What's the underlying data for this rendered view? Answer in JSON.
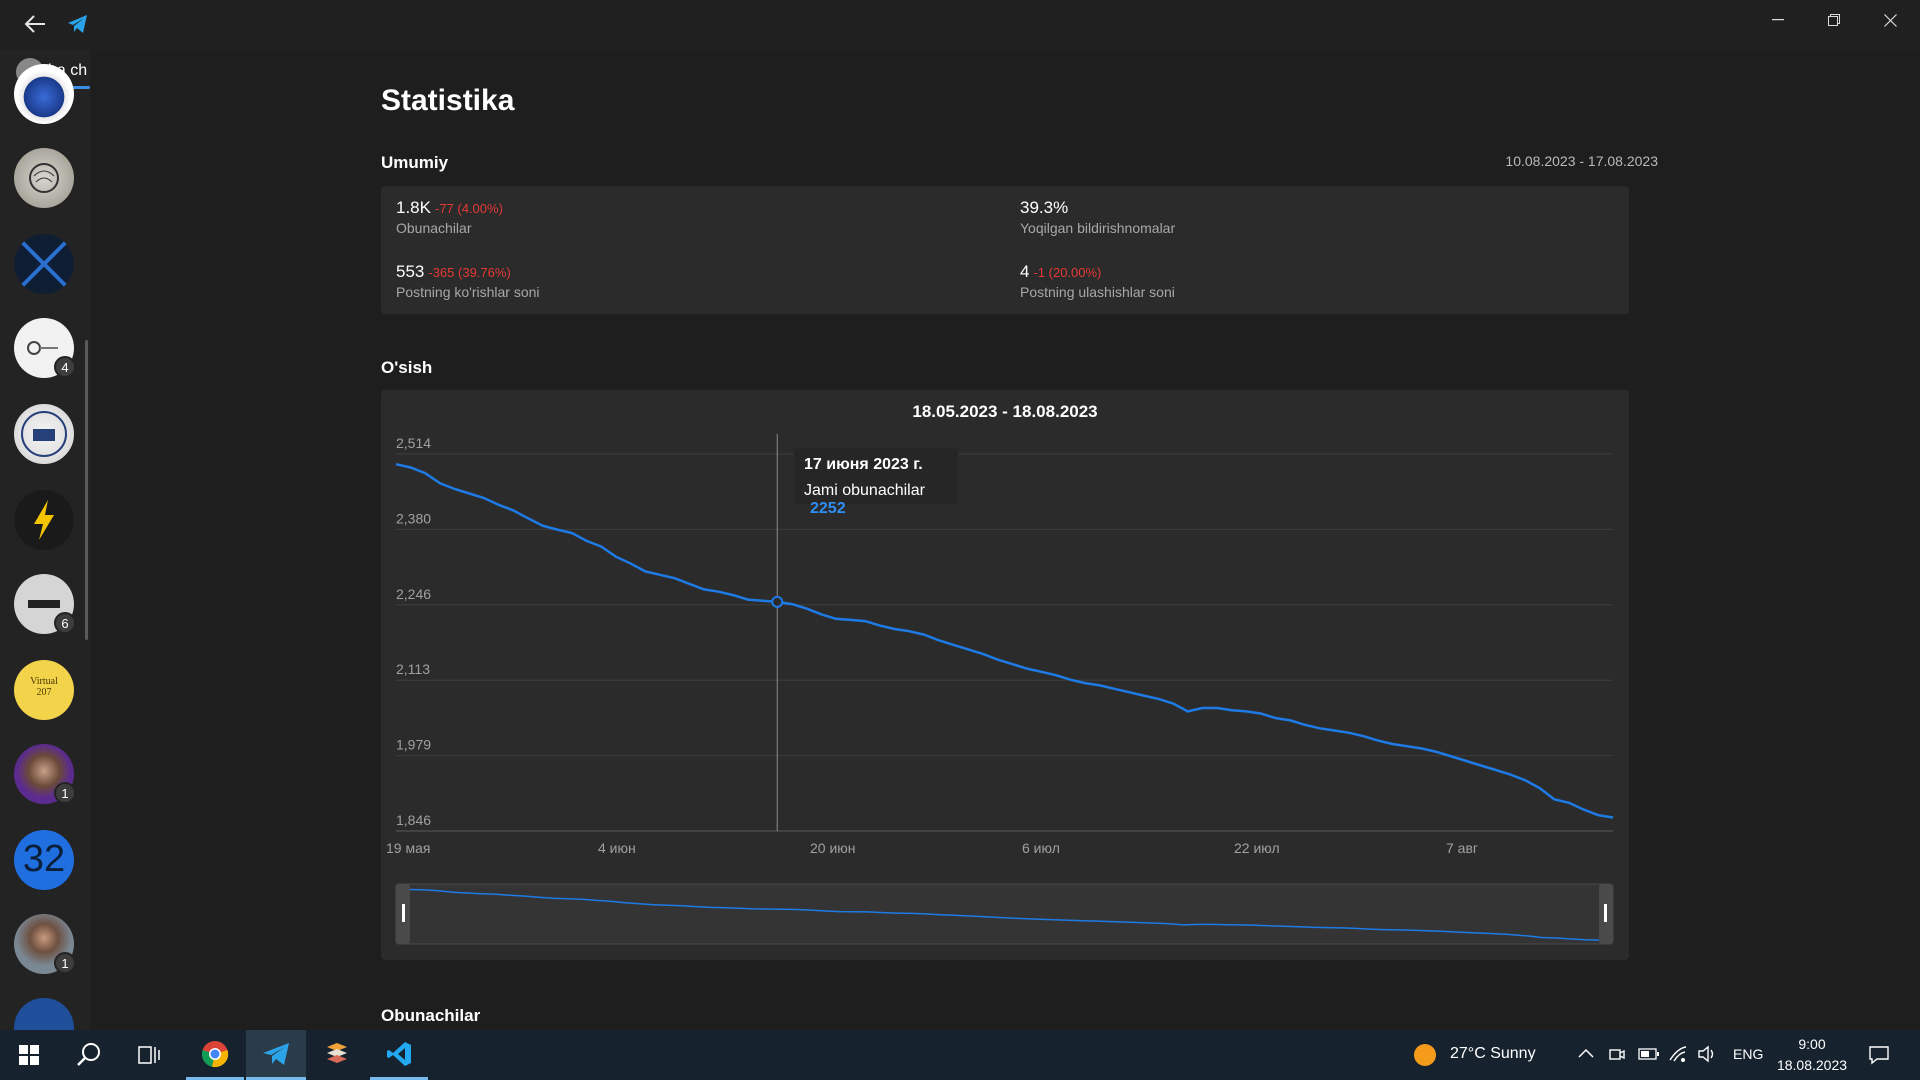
{
  "window": {
    "folder_label": "ha ch"
  },
  "chats": [
    {
      "name": "chat-1",
      "badge": ""
    },
    {
      "name": "chat-2",
      "badge": ""
    },
    {
      "name": "chat-3",
      "badge": ""
    },
    {
      "name": "chat-4",
      "badge": "4"
    },
    {
      "name": "chat-5",
      "badge": ""
    },
    {
      "name": "chat-6",
      "badge": ""
    },
    {
      "name": "chat-7",
      "badge": "6"
    },
    {
      "name": "chat-8",
      "badge": ""
    },
    {
      "name": "chat-9",
      "badge": "1"
    },
    {
      "name": "chat-10",
      "badge": ""
    },
    {
      "name": "chat-11",
      "badge": "1"
    },
    {
      "name": "chat-12",
      "badge": ""
    }
  ],
  "chat_texts": {
    "virtual": "Virtual",
    "virtual_num": "207",
    "thirtytwo": "32"
  },
  "page": {
    "title": "Statistika"
  },
  "overview": {
    "title": "Umumiy",
    "date_range": "10.08.2023 - 17.08.2023",
    "stats": [
      {
        "value": "1.8K",
        "delta": "-77 (4.00%)",
        "label": "Obunachilar"
      },
      {
        "value": "39.3%",
        "delta": "",
        "label": "Yoqilgan bildirishnomalar"
      },
      {
        "value": "553",
        "delta": "-365 (39.76%)",
        "label": "Postning ko'rishlar soni"
      },
      {
        "value": "4",
        "delta": "-1 (20.00%)",
        "label": "Postning ulashishlar soni"
      }
    ]
  },
  "growth": {
    "title": "O'sish",
    "tooltip_date": "17 июня 2023 г.",
    "tooltip_label": "Jami obunachilar",
    "tooltip_value": "2252"
  },
  "subscribers": {
    "title": "Obunachilar"
  },
  "chart_data": {
    "type": "line",
    "title": "18.05.2023 - 18.08.2023",
    "xlabel": "",
    "ylabel": "",
    "y_ticks": [
      "2,514",
      "2,380",
      "2,246",
      "2,113",
      "1,979",
      "1,846"
    ],
    "x_ticks": [
      "19 мая",
      "4 июн",
      "20 июн",
      "6 июл",
      "22 июл",
      "7 авг"
    ],
    "ylim": [
      1846,
      2514
    ],
    "line_color": "#1e7be6",
    "series": [
      {
        "values": [
          2496,
          2490,
          2480,
          2462,
          2452,
          2444,
          2436,
          2424,
          2414,
          2400,
          2387,
          2380,
          2374,
          2360,
          2350,
          2332,
          2320,
          2306,
          2300,
          2294,
          2284,
          2274,
          2270,
          2264,
          2256,
          2254,
          2252,
          2248,
          2240,
          2230,
          2222,
          2220,
          2218,
          2210,
          2204,
          2200,
          2194,
          2184,
          2176,
          2168,
          2160,
          2150,
          2142,
          2134,
          2128,
          2122,
          2114,
          2108,
          2104,
          2098,
          2092,
          2086,
          2080,
          2072,
          2058,
          2064,
          2064,
          2060,
          2058,
          2054,
          2046,
          2042,
          2034,
          2028,
          2024,
          2020,
          2014,
          2006,
          2000,
          1996,
          1992,
          1986,
          1978,
          1970,
          1962,
          1954,
          1946,
          1936,
          1922,
          1902,
          1896,
          1884,
          1874,
          1870
        ]
      }
    ]
  },
  "taskbar": {
    "weather": "27°C  Sunny",
    "lang": "ENG",
    "time": "9:00",
    "date": "18.08.2023"
  }
}
